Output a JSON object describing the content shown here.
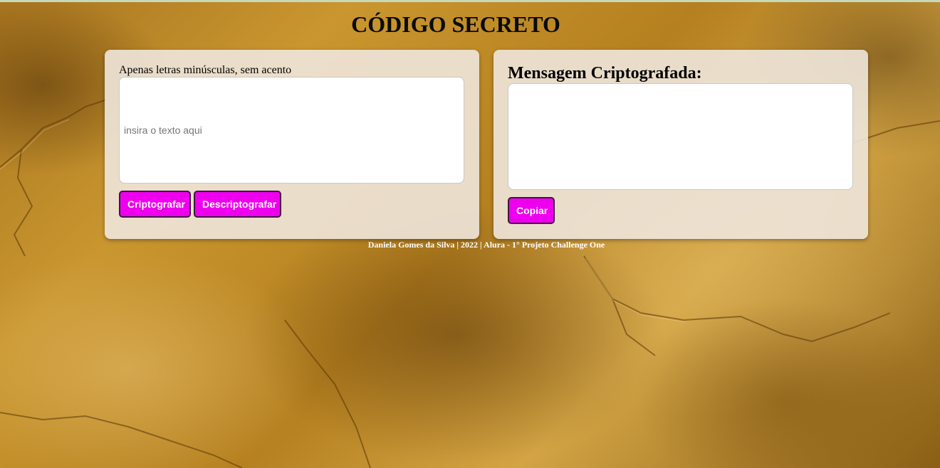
{
  "page": {
    "title": "CÓDIGO SECRETO",
    "footer": "Daniela Gomes da Silva | 2022 | Alura - 1° Projeto Challenge One"
  },
  "input_panel": {
    "instruction": "Apenas letras minúsculas, sem acento",
    "placeholder": "insira o texto aqui",
    "value": "",
    "encrypt_label": "Criptografar",
    "decrypt_label": "Descriptografar"
  },
  "output_panel": {
    "heading": "Mensagem Criptografada:",
    "value": "",
    "copy_label": "Copiar"
  },
  "colors": {
    "button_bg": "#ee00ee",
    "button_text": "#ffffff",
    "panel_bg": "#eee6dc",
    "background_accent": "#b5801f"
  }
}
